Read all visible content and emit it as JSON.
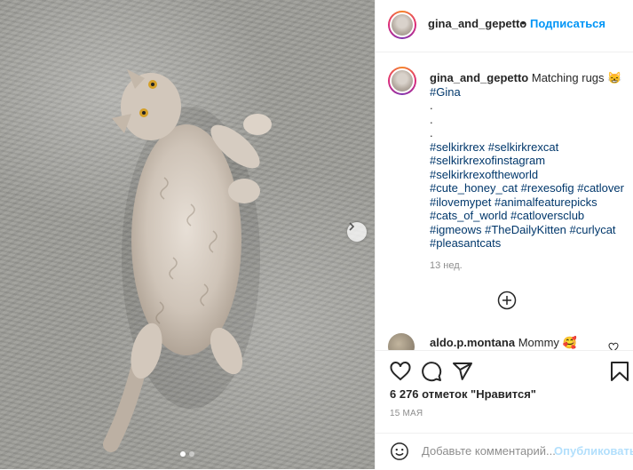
{
  "post": {
    "image_alt": "Selkirk Rex cat lying on a grey rug",
    "carousel": {
      "count": 2,
      "active": 1
    }
  },
  "header": {
    "username": "gina_and_gepetto",
    "bullet": "•",
    "follow_label": "Подписаться"
  },
  "caption": {
    "username": "gina_and_gepetto",
    "text": "Matching rugs 😸",
    "lines": [
      "#Gina",
      ".",
      ".",
      ".",
      "#selkirkrex #selkirkrexcat",
      "#selkirkrexofinstagram",
      "#selkirkrexoftheworld",
      "#cute_honey_cat #rexesofig #catlover",
      "#ilovemypet #animalfeaturepicks",
      "#cats_of_world #catloversclub",
      "#igmeows #TheDailyKitten #curlycat",
      "#pleasantcats"
    ],
    "time": "13 нед."
  },
  "comment": {
    "username": "aldo.p.montana",
    "text": "Mommy 🥰"
  },
  "actions": {
    "likes": "6 276 отметок \"Нравится\"",
    "date": "15 МАЯ"
  },
  "add_comment": {
    "placeholder": "Добавьте комментарий...",
    "publish_label": "Опубликовать"
  },
  "icons": {
    "like": "heart-icon",
    "comment": "comment-icon",
    "share": "share-icon",
    "save": "bookmark-icon",
    "emoji": "emoji-icon",
    "more": "plus-circle-icon",
    "next": "chevron-right-icon"
  },
  "colors": {
    "link": "#00376b",
    "follow": "#0095f6",
    "publish_disabled": "#b2dffc",
    "meta": "#8e8e8e"
  }
}
